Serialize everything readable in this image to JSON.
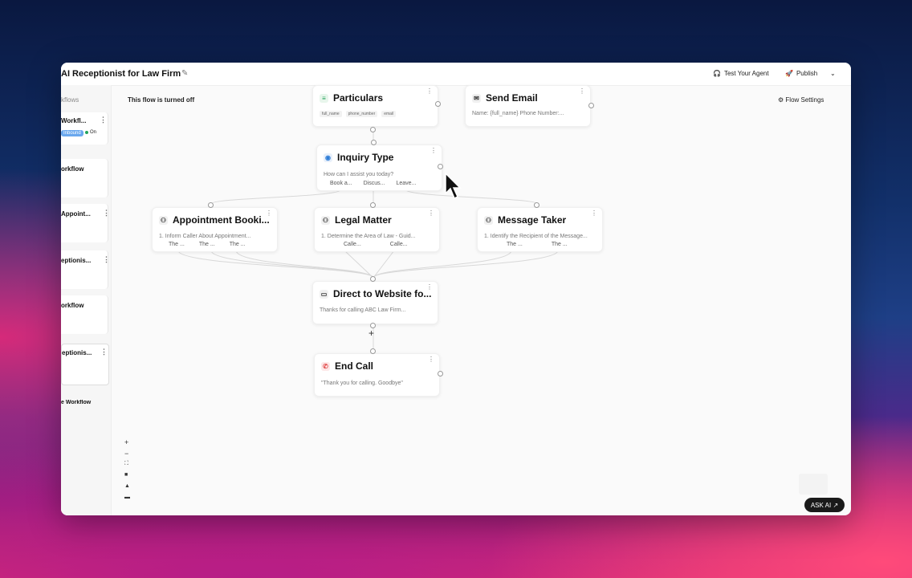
{
  "header": {
    "title": "AI Receptionist for Law Firm",
    "test_agent": "Test Your Agent",
    "publish": "Publish"
  },
  "sidebar": {
    "section_label": "kflows",
    "items": [
      {
        "label": "Workfl...",
        "badge": "Inbound",
        "status": "On"
      },
      {
        "label": "orkflow"
      },
      {
        "label": "Appoint..."
      },
      {
        "label": "eptionis..."
      },
      {
        "label": "orkflow"
      },
      {
        "label": "eptionis..."
      }
    ],
    "add_workflow": "e Workflow"
  },
  "canvas": {
    "flow_status": "This flow is turned off",
    "flow_settings": "Flow Settings",
    "nodes": {
      "particulars": {
        "title": "Particulars",
        "tags": [
          "full_name",
          "phone_number",
          "email"
        ]
      },
      "send_email": {
        "title": "Send Email",
        "subtitle": "Name: {full_name} Phone Number:..."
      },
      "inquiry_type": {
        "title": "Inquiry Type",
        "subtitle": "How can I assist you today?",
        "options": [
          "Book a...",
          "Discus...",
          "Leave..."
        ]
      },
      "appointment": {
        "title": "Appointment Booki...",
        "subtitle": "1. Inform Caller About Appointment...",
        "options": [
          "The ...",
          "The ...",
          "The ..."
        ]
      },
      "legal_matter": {
        "title": "Legal Matter",
        "subtitle": "1. Determine the Area of Law - Guid...",
        "options": [
          "Calle...",
          "Calle..."
        ]
      },
      "message_taker": {
        "title": "Message Taker",
        "subtitle": "1. Identify the Recipient of the Message...",
        "options": [
          "The ...",
          "The ..."
        ]
      },
      "direct_website": {
        "title": "Direct to Website fo...",
        "subtitle": "Thanks for calling ABC Law Firm..."
      },
      "end_call": {
        "title": "End Call",
        "subtitle": "\"Thank you for calling. Goodbye\""
      }
    },
    "ask_ai": "ASK AI"
  },
  "colors": {
    "accent": "#2e7dd7",
    "on": "#22a35a",
    "end_call": "#e04646"
  }
}
